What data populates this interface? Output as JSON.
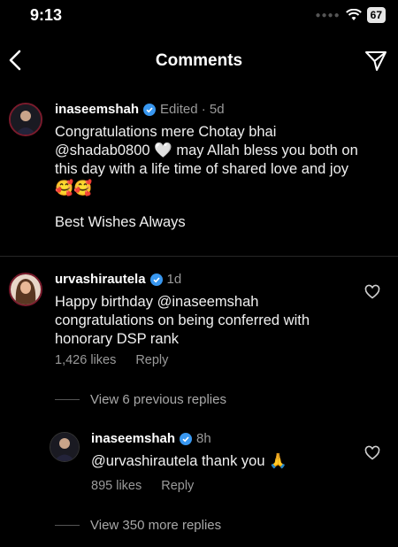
{
  "status": {
    "time": "9:13",
    "battery": "67"
  },
  "header": {
    "title": "Comments"
  },
  "comments": [
    {
      "username": "inaseemshah",
      "meta": "Edited · 5d",
      "text_line1": "Congratulations mere Chotay bhai",
      "text_line2_a": "@shadab0800",
      "text_line2_emoji": "🤍",
      "text_line2_b": "may Allah bless you both on",
      "text_line3": "this day with a life time of shared love and joy",
      "text_emojis": "🥰🥰",
      "text_extra": "Best Wishes Always"
    },
    {
      "username": "urvashirautela",
      "meta": "1d",
      "text_line1": "Happy birthday @inaseemshah",
      "text_line2": "congratulations on being conferred with",
      "text_line3": "honorary DSP rank",
      "likes": "1,426 likes",
      "reply": "Reply",
      "view_replies": "View 6 previous replies"
    }
  ],
  "reply": {
    "username": "inaseemshah",
    "meta": "8h",
    "text": "@urvashirautela thank you",
    "emoji": "🙏",
    "likes": "895 likes",
    "reply": "Reply",
    "view_more": "View 350 more replies"
  },
  "icons": {
    "back": "chevron-left-icon",
    "send": "paper-plane-icon",
    "heart": "heart-outline-icon",
    "verified": "verified-badge-icon"
  },
  "colors": {
    "background": "#000000",
    "verified": "#3897f0",
    "muted": "#9a9a9a"
  }
}
